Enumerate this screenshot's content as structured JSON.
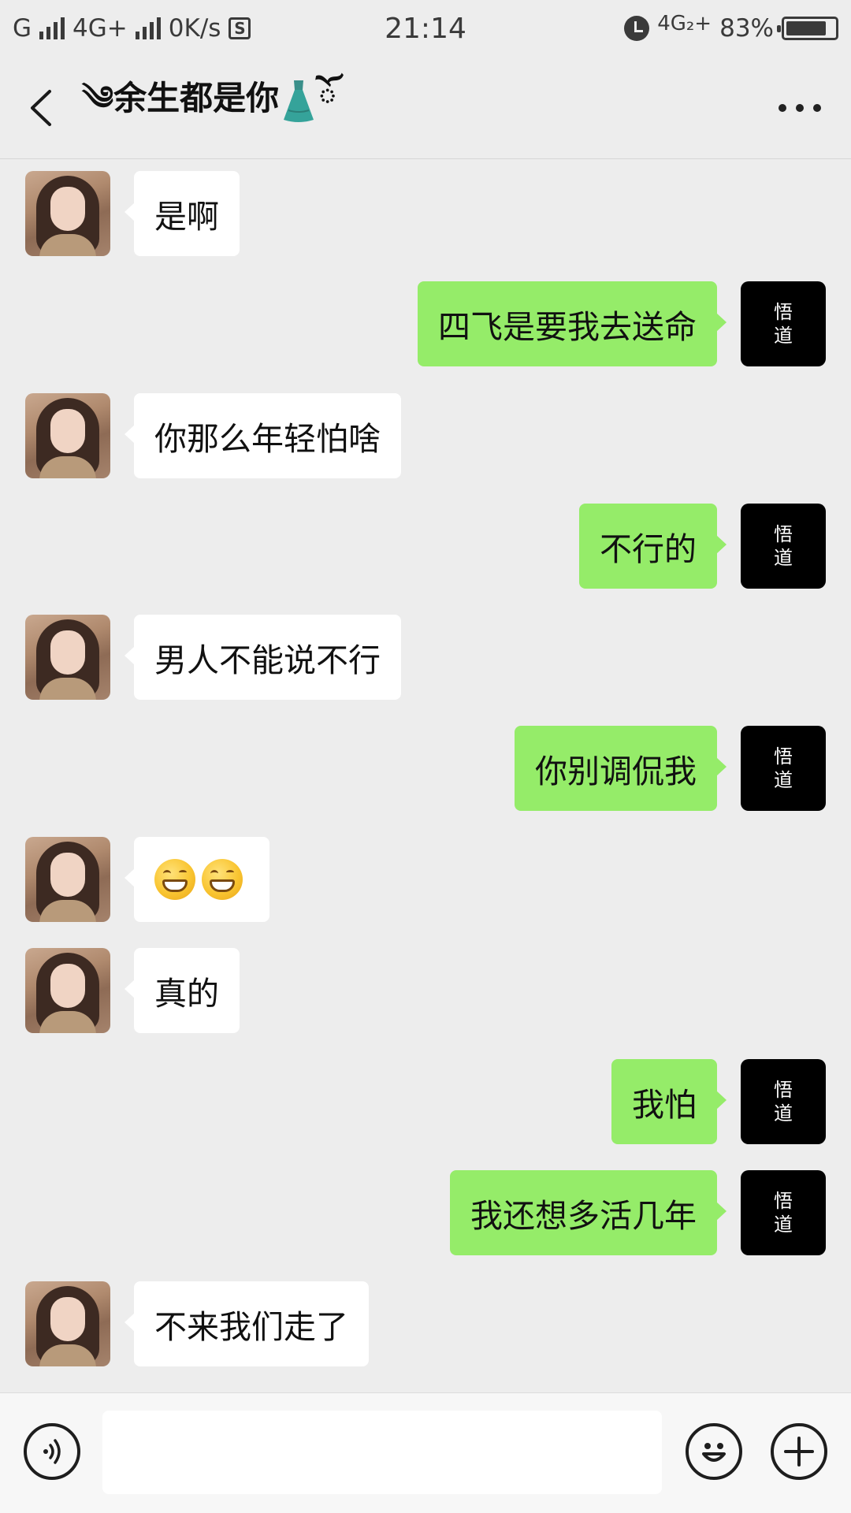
{
  "status_bar": {
    "carrier1": "G",
    "network2": "4G+",
    "speed": "0K/s",
    "sim_badge": "S",
    "time": "21:14",
    "network_right": "4G₂+",
    "battery": "83%",
    "battery_level": 0.83
  },
  "header": {
    "title_prefix": "༄余生都是你",
    "title_suffix": "ོ",
    "icons": [
      "back-chevron-icon",
      "dress-icon",
      "more-dots-icon"
    ]
  },
  "contacts": {
    "self_avatar_line1": "悟",
    "self_avatar_line2": "道"
  },
  "messages": [
    {
      "from": "other",
      "text": "是啊"
    },
    {
      "from": "self",
      "text": "四飞是要我去送命"
    },
    {
      "from": "other",
      "text": "你那么年轻怕啥"
    },
    {
      "from": "self",
      "text": "不行的"
    },
    {
      "from": "other",
      "text": "男人不能说不行"
    },
    {
      "from": "self",
      "text": "你别调侃我"
    },
    {
      "from": "other",
      "text": "",
      "emoji": [
        "grin-emoji",
        "grin-emoji"
      ]
    },
    {
      "from": "other",
      "text": "真的"
    },
    {
      "from": "self",
      "text": "我怕"
    },
    {
      "from": "self",
      "text": "我还想多活几年"
    },
    {
      "from": "other",
      "text": "不来我们走了"
    }
  ],
  "input_bar": {
    "value": "",
    "icons": [
      "voice-icon",
      "emoji-icon",
      "plus-icon"
    ]
  },
  "colors": {
    "background": "#ededed",
    "outgoing_bubble": "#95ec69",
    "incoming_bubble": "#ffffff",
    "self_avatar": "#000000"
  }
}
